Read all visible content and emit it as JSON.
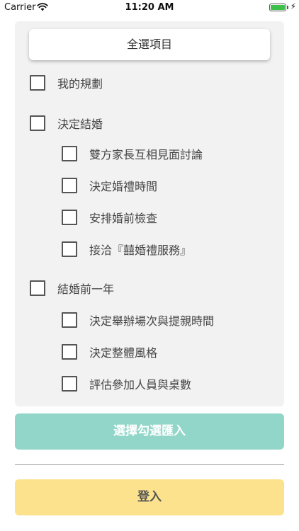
{
  "status_bar": {
    "carrier": "Carrier",
    "time": "11:20 AM",
    "battery_level": 1.0,
    "battery_color": "#3cc04a",
    "wifi_icon": "wifi-icon",
    "charging_icon": "bolt-icon"
  },
  "checklist": {
    "select_all_label": "全選項目",
    "items": [
      {
        "label": "我的規劃",
        "level": 0,
        "checked": false
      },
      {
        "label": "決定結婚",
        "level": 0,
        "checked": false
      },
      {
        "label": "雙方家長互相見面討論",
        "level": 1,
        "checked": false
      },
      {
        "label": "決定婚禮時間",
        "level": 1,
        "checked": false
      },
      {
        "label": "安排婚前檢查",
        "level": 1,
        "checked": false
      },
      {
        "label": "接洽『囍婚禮服務』",
        "level": 1,
        "checked": false
      },
      {
        "label": "結婚前一年",
        "level": 0,
        "checked": false
      },
      {
        "label": "決定舉辦場次與提親時間",
        "level": 1,
        "checked": false
      },
      {
        "label": "決定整體風格",
        "level": 1,
        "checked": false
      },
      {
        "label": "評估參加人員與桌數",
        "level": 1,
        "checked": false
      }
    ]
  },
  "actions": {
    "import_label": "選擇勾選匯入",
    "import_color": "#91d6c8",
    "login_label": "登入",
    "login_color": "#fce28c"
  }
}
